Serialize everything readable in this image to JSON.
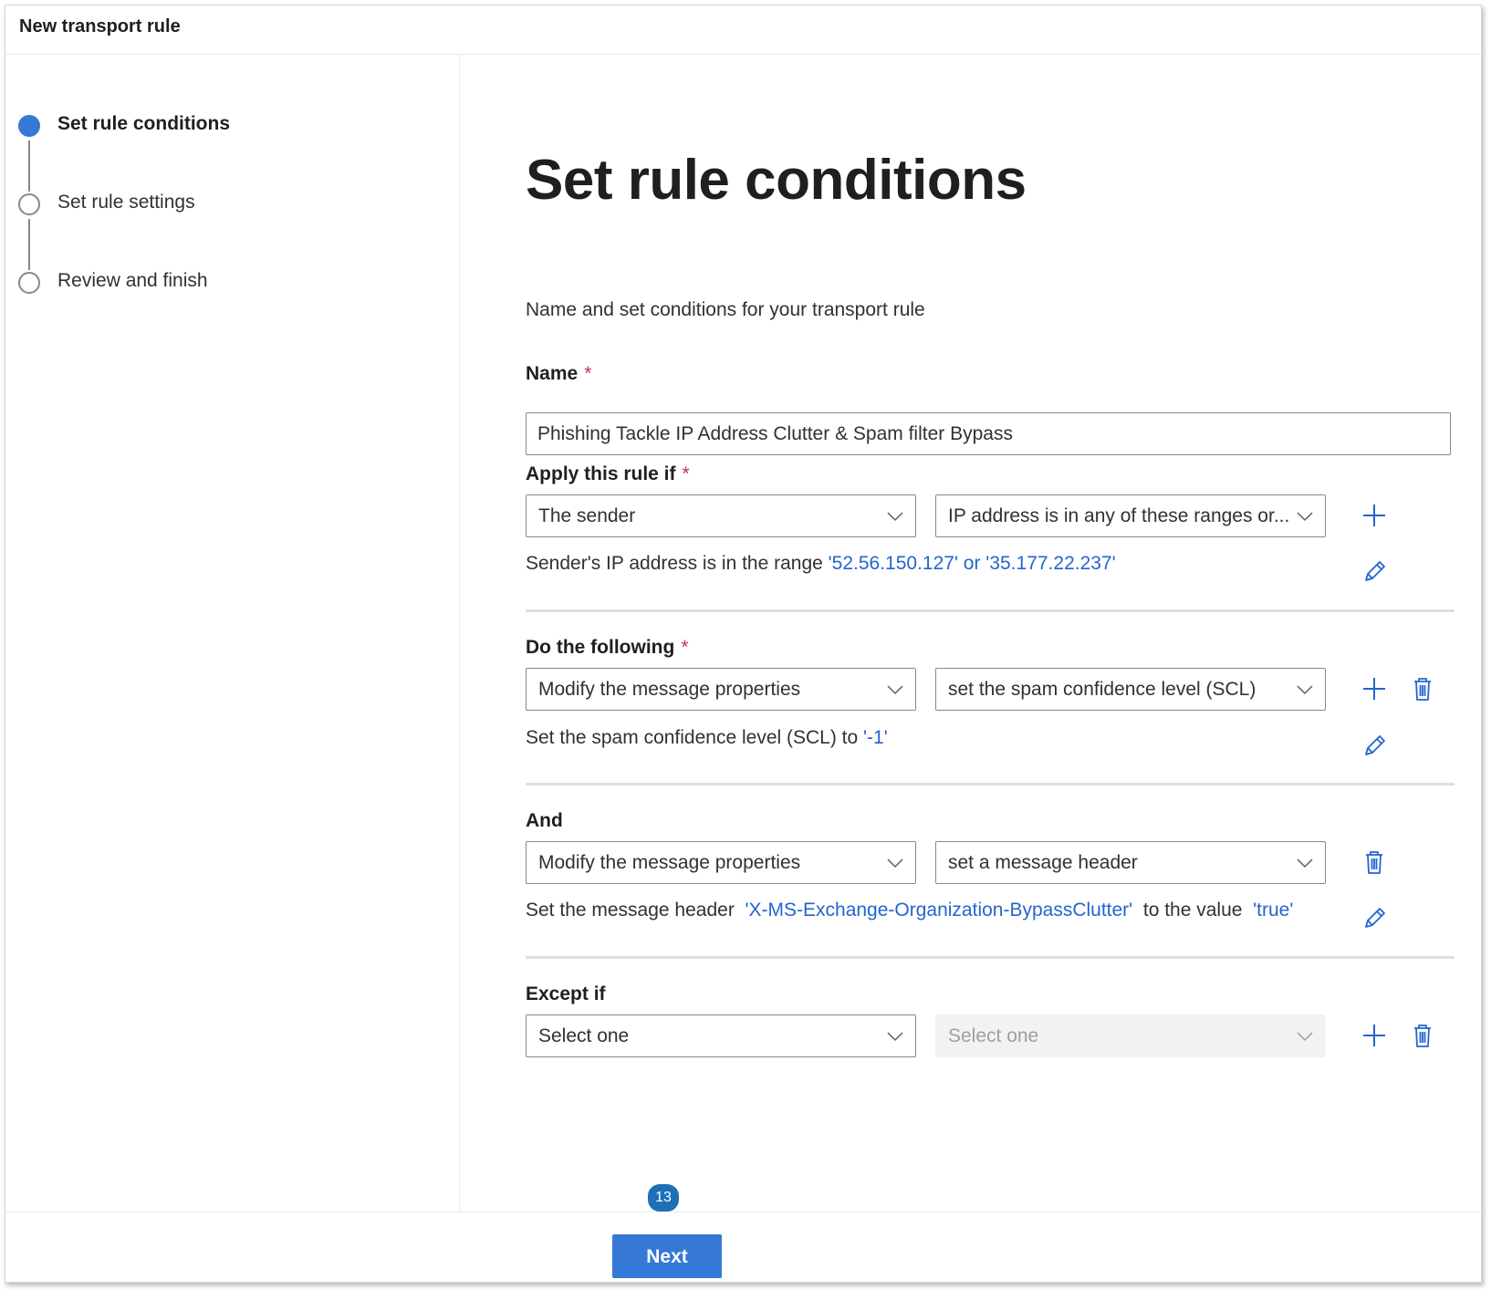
{
  "window": {
    "title": "New transport rule"
  },
  "steps": [
    {
      "label": "Set rule conditions",
      "state": "active"
    },
    {
      "label": "Set rule settings",
      "state": "pending"
    },
    {
      "label": "Review and finish",
      "state": "pending"
    }
  ],
  "main": {
    "heading": "Set rule conditions",
    "subtitle": "Name and set conditions for your transport rule",
    "name": {
      "label": "Name",
      "required_mark": "*",
      "value": "Phishing Tackle IP Address Clutter & Spam filter Bypass"
    },
    "apply": {
      "label": "Apply this rule if",
      "required_mark": "*",
      "dropdown1": "The sender",
      "dropdown2": "IP address is in any of these ranges or...",
      "desc_prefix": "Sender's IP address is in the range ",
      "desc_link": "'52.56.150.127' or '35.177.22.237'"
    },
    "do": {
      "label": "Do the following",
      "required_mark": "*",
      "dropdown1": "Modify the message properties",
      "dropdown2": "set the spam confidence level (SCL)",
      "desc_prefix": "Set the spam confidence level (SCL) to ",
      "desc_link": "'-1'"
    },
    "and": {
      "label": "And",
      "dropdown1": "Modify the message properties",
      "dropdown2": "set a message header",
      "desc_prefix": "Set the message header ",
      "desc_link1": "'X-MS-Exchange-Organization-BypassClutter'",
      "desc_mid": " to the value ",
      "desc_link2": "'true'"
    },
    "except": {
      "label": "Except if",
      "dropdown1": "Select one",
      "dropdown2": "Select one"
    }
  },
  "footer": {
    "next_label": "Next",
    "badge": "13"
  },
  "colors": {
    "accent": "#3578d6",
    "link": "#2564cf",
    "required": "#c4314b",
    "badge": "#1f6fb8"
  }
}
